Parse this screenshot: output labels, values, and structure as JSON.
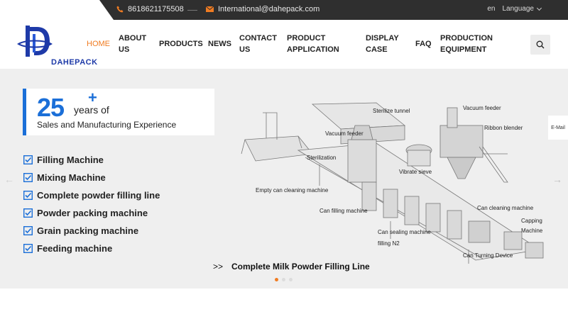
{
  "topbar": {
    "phone": "8618621175508",
    "email": "International@dahepack.com",
    "lang_code": "en",
    "lang_label": "Language"
  },
  "header": {
    "logo_text": "DAHEPACK",
    "nav": [
      {
        "label": "HOME",
        "active": true
      },
      {
        "label": "ABOUT US"
      },
      {
        "label": "PRODUCTS"
      },
      {
        "label": "NEWS"
      },
      {
        "label": "CONTACT US"
      },
      {
        "label": "PRODUCT APPLICATION"
      },
      {
        "label": "DISPLAY CASE"
      },
      {
        "label": "FAQ"
      },
      {
        "label": "PRODUCTION EQUIPMENT"
      }
    ]
  },
  "banner": {
    "years_number": "25",
    "years_plus": "+",
    "years_text": "years of",
    "experience": "Sales and Manufacturing Experience",
    "features": [
      "Filling Machine",
      "Mixing Machine",
      "Complete powder filling line",
      "Powder packing machine",
      "Grain packing machine",
      "Feeding machine"
    ],
    "caption_prefix": ">>",
    "caption": "Complete Milk Powder Filling Line",
    "machine_labels": {
      "sterilize_tunnel": "Sterilize tunnel",
      "vacuum_feeder_top": "Vacuum feeder",
      "ribbon_blender": "Ribbon blender",
      "vacuum_feeder": "Vacuum feeder",
      "sterilization": "Sterilization",
      "vibrate_sieve": "Vibrate sieve",
      "empty_can": "Empty can cleaning machine",
      "can_filling": "Can filling machine",
      "can_cleaning": "Can cleaning machine",
      "capping": "Capping",
      "machine": "Machine",
      "can_sealing": "Can sealing machine",
      "filling_n2": "filling N2",
      "can_turning": "Can Turning Device"
    },
    "email_tab": "E-Mail",
    "arrow_prev": "←",
    "arrow_next": "→",
    "slides": 3,
    "active_slide": 0
  },
  "colors": {
    "accent": "#f07c22",
    "brand_blue": "#1b6fd8",
    "topbar_bg": "#2f2f2f",
    "banner_bg": "#efefef"
  }
}
